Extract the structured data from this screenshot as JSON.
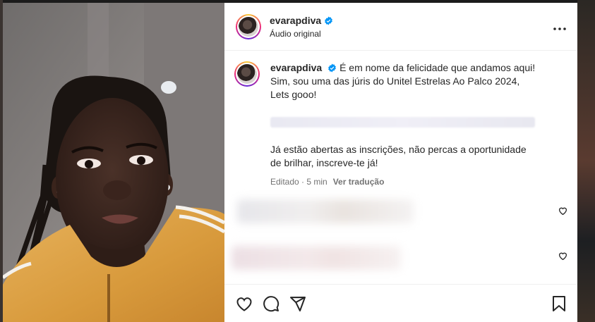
{
  "post": {
    "username": "evarapdiva",
    "audio_label": "Áudio original",
    "caption_line1": "É em nome da felicidade que andamos aqui! Sim, sou uma das júris do Unitel Estrelas Ao Palco 2024, Lets gooo!",
    "caption_line2": "Já estão abertas as inscrições, não percas a oportunidade de brilhar, inscreve-te já!",
    "edited_label": "Editado · 5 min",
    "translate_label": "Ver tradução"
  },
  "icons": [
    "more-icon",
    "verified-icon",
    "heart-icon",
    "comment-icon",
    "share-icon",
    "bookmark-icon"
  ],
  "colors": {
    "text": "#262626",
    "muted": "#737373",
    "verified": "#0095f6"
  }
}
